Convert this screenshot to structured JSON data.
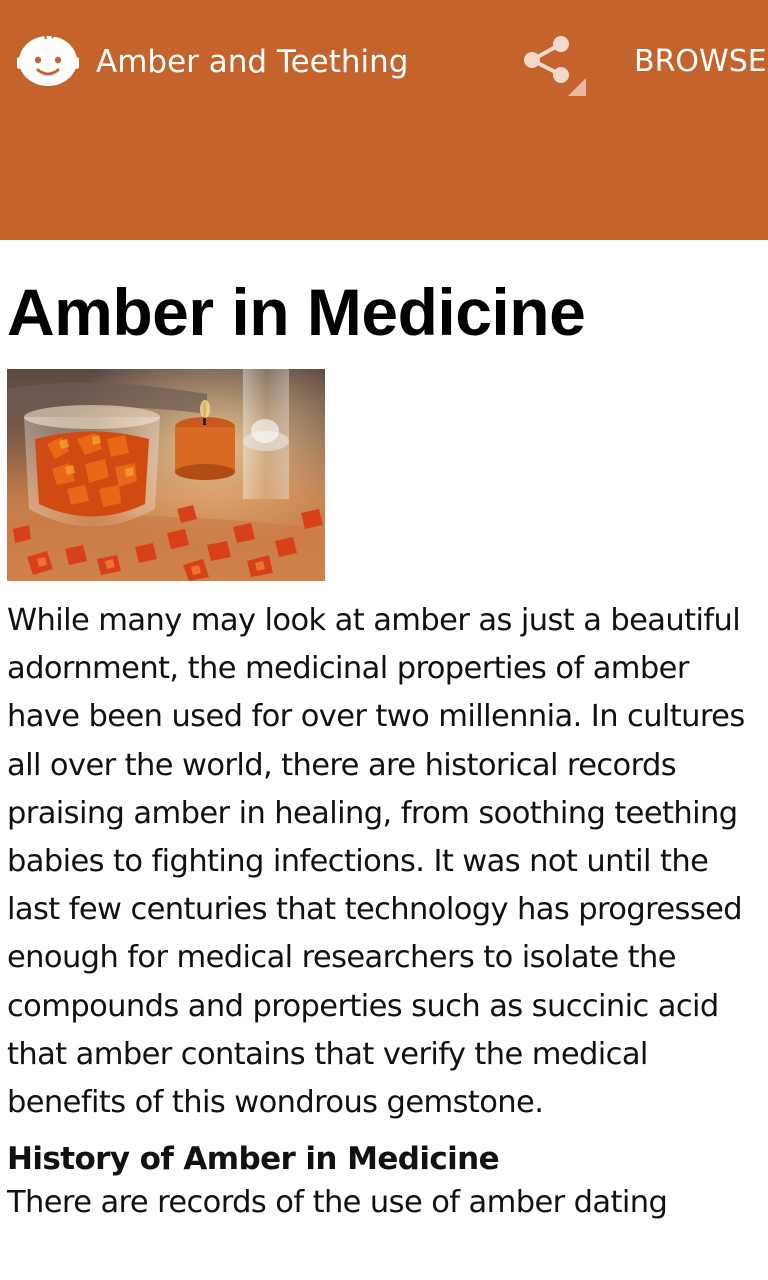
{
  "app_bar": {
    "title": "Amber and Teething",
    "share_icon": "share-icon",
    "browse_label": "BROWSE",
    "background_color": "#c4632c",
    "avatar_icon": "baby-face-icon"
  },
  "article": {
    "title": "Amber in Medicine",
    "image_alt": "amber-stones-in-glass-photo",
    "paragraph_1": "While many may look at amber as just a beautiful adornment, the medicinal properties of amber have been used for over two millennia. In cultures all over the world, there are historical records praising amber in healing, from soothing teething babies to fighting infections. It was not until the last few centuries that technology has progressed enough for medical researchers to isolate the compounds and properties such as succinic acid that amber contains that verify the medical benefits of this wondrous gemstone.",
    "section_heading": "History of Amber in Medicine",
    "paragraph_2": "There are records of the use of amber dating"
  }
}
